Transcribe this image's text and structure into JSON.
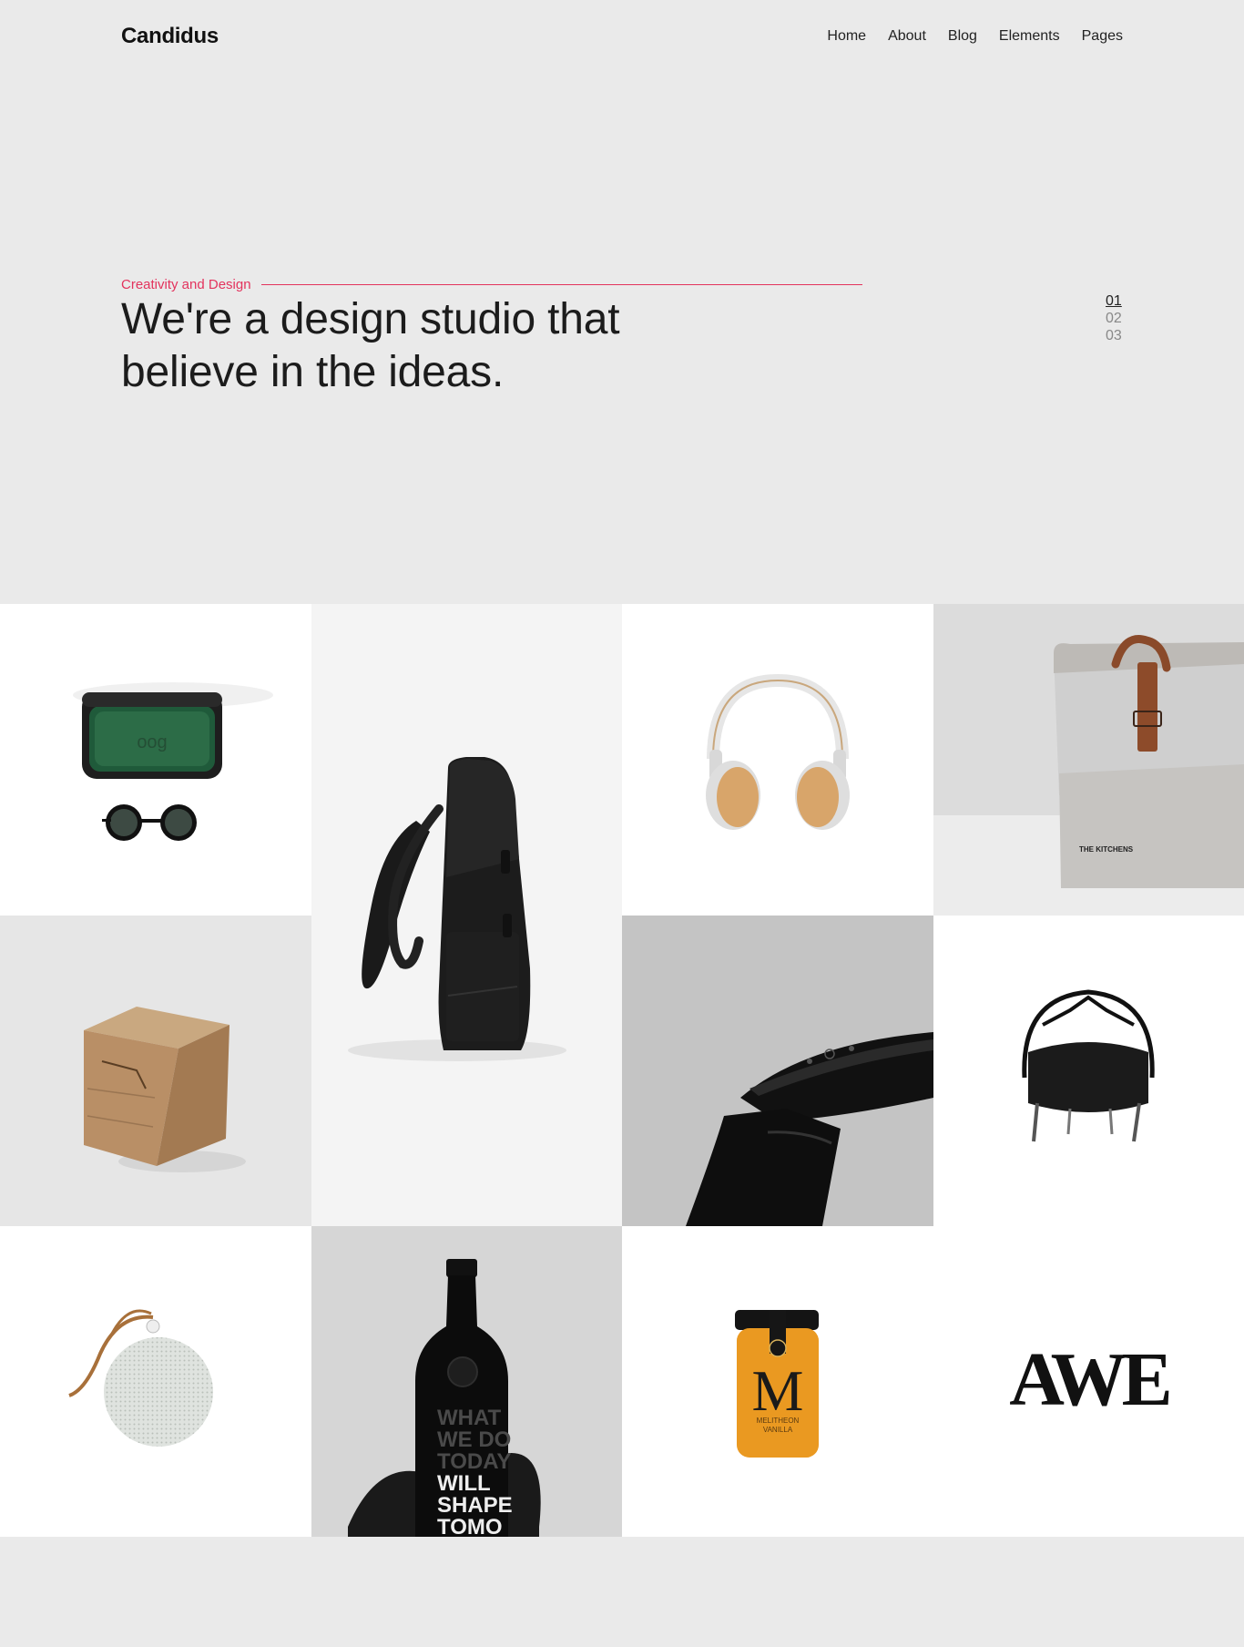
{
  "header": {
    "logo": "Candidus",
    "nav": [
      "Home",
      "About",
      "Blog",
      "Elements",
      "Pages"
    ]
  },
  "hero": {
    "eyebrow": "Creativity and Design",
    "title_line1": "We're a design studio that",
    "title_line2": "believe in the ideas.",
    "slides": [
      "01",
      "02",
      "03"
    ],
    "active_slide": "01"
  },
  "portfolio": {
    "tiles": [
      {
        "name": "glasses-case",
        "bg": "#ffffff"
      },
      {
        "name": "backpack",
        "bg": "#f4f4f4"
      },
      {
        "name": "headphones",
        "bg": "#ffffff"
      },
      {
        "name": "paper-bag",
        "bg": "#dcdcdc"
      },
      {
        "name": "wood-cube",
        "bg": "#e6e6e6"
      },
      {
        "name": "smartwatch",
        "bg": "#c4c4c4"
      },
      {
        "name": "chair",
        "bg": "#ffffff"
      },
      {
        "name": "speaker",
        "bg": "#ffffff"
      },
      {
        "name": "wine-bottle",
        "bg": "#d6d6d6"
      },
      {
        "name": "honey-jar",
        "bg": "#ffffff"
      },
      {
        "name": "awe-logo",
        "bg": "#ffffff"
      }
    ],
    "bag_print": "THE KITCHENS",
    "bottle_text": [
      "WHAT",
      "WE DO",
      "TODAY",
      "WILL",
      "SHAPE",
      "TOMO"
    ],
    "jar_text": [
      "M",
      "MELITHEON",
      "VANILLA"
    ],
    "logo_text": "AWE"
  },
  "colors": {
    "accent": "#e3335d",
    "page_bg": "#eaeaea"
  }
}
